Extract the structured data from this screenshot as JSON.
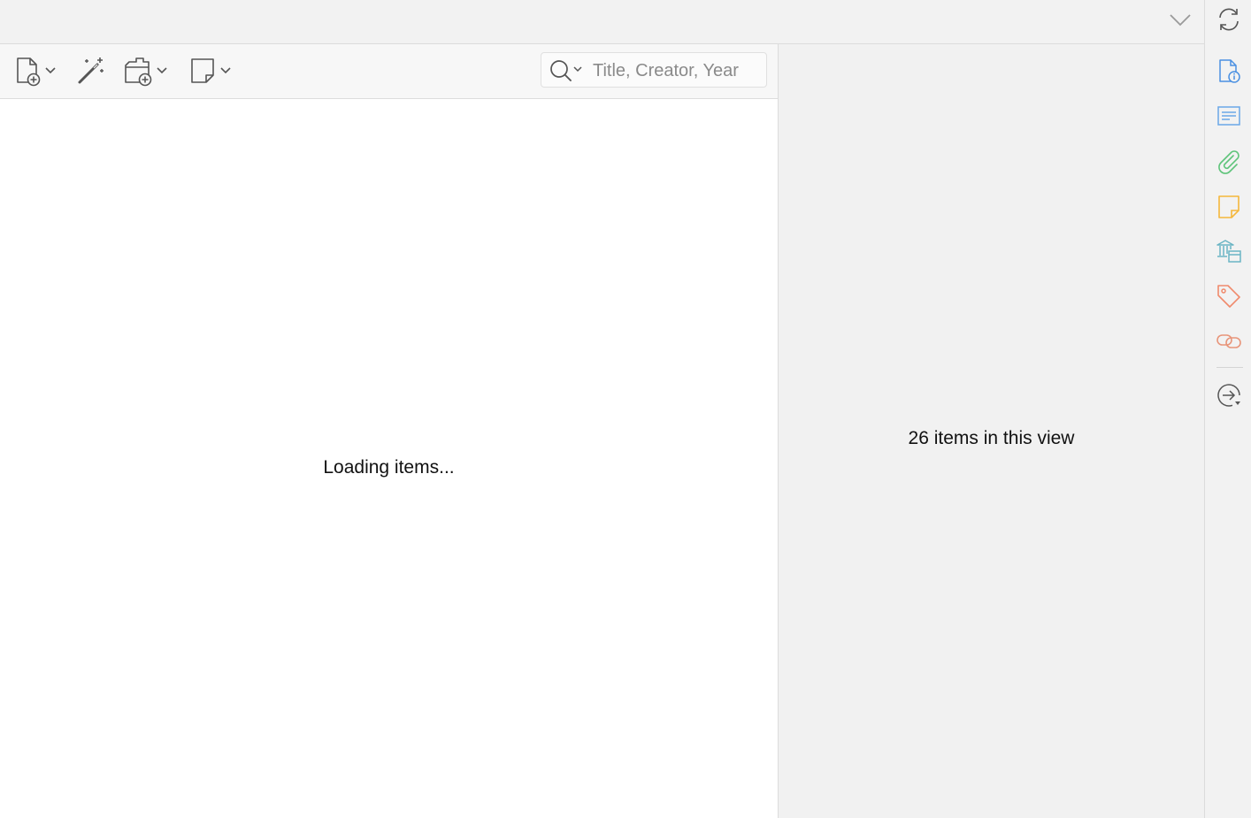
{
  "toolbar": {
    "new_item_icon": "new-item-icon",
    "magic_wand_icon": "magic-wand-icon",
    "add_attachment_icon": "add-attachment-icon",
    "new_note_icon": "new-note-icon"
  },
  "search": {
    "placeholder": "Title, Creator, Year",
    "value": ""
  },
  "items_pane": {
    "message": "Loading items..."
  },
  "item_pane": {
    "message": "26 items in this view"
  },
  "sidenav": {
    "items": [
      {
        "name": "info-icon",
        "color": "#4a90e2"
      },
      {
        "name": "abstract-icon",
        "color": "#6aa8e8"
      },
      {
        "name": "attachments-icon",
        "color": "#5ec47a"
      },
      {
        "name": "notes-icon",
        "color": "#f5b73b"
      },
      {
        "name": "libraries-collections-icon",
        "color": "#6bb5c4"
      },
      {
        "name": "tags-icon",
        "color": "#f08a6c"
      },
      {
        "name": "related-icon",
        "color": "#e8957a"
      },
      {
        "name": "locate-icon",
        "color": "#555555"
      }
    ]
  },
  "colors": {
    "toolbar_icon": "#555555",
    "chrome_bg": "#f2f2f2",
    "pane_bg": "#ffffff"
  }
}
